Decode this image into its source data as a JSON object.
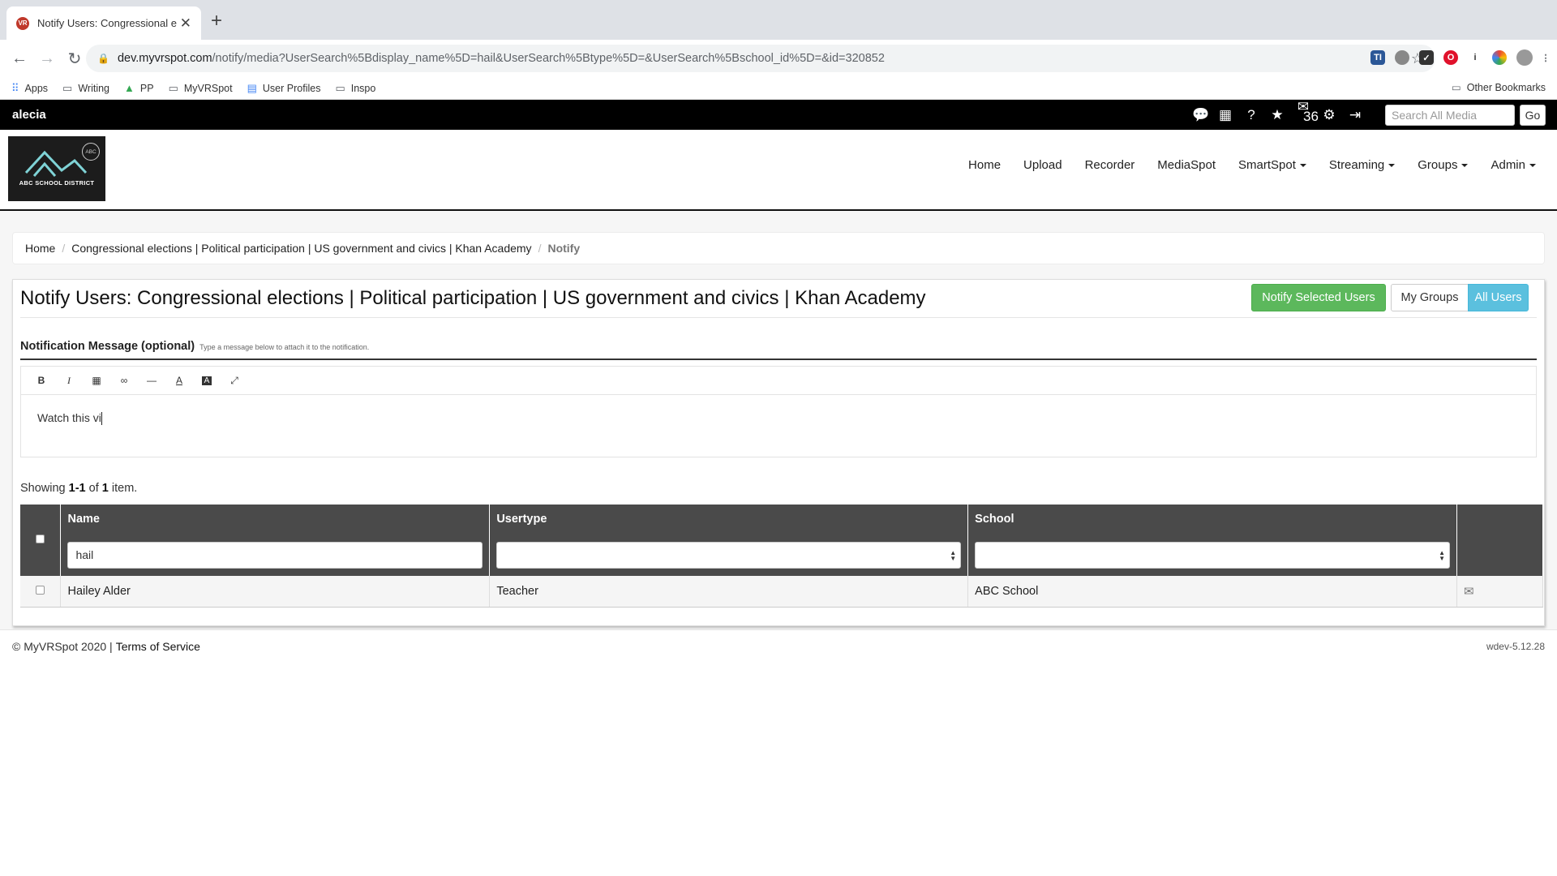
{
  "browser": {
    "tab_title": "Notify Users: Congressional el",
    "url_host": "dev.myvrspot.com",
    "url_path": "/notify/media?UserSearch%5Bdisplay_name%5D=hail&UserSearch%5Btype%5D=&UserSearch%5Bschool_id%5D=&id=320852",
    "bookmarks": [
      "Apps",
      "Writing",
      "PP",
      "MyVRSpot",
      "User Profiles",
      "Inspo"
    ],
    "other_bookmarks": "Other Bookmarks"
  },
  "topbar": {
    "username": "alecia",
    "mail_count": "36",
    "search_placeholder": "Search All Media",
    "go_label": "Go"
  },
  "logo": {
    "badge": "ABC",
    "district_name": "ABC SCHOOL DISTRICT"
  },
  "nav": {
    "home": "Home",
    "upload": "Upload",
    "recorder": "Recorder",
    "mediaspot": "MediaSpot",
    "smartspot": "SmartSpot",
    "streaming": "Streaming",
    "groups": "Groups",
    "admin": "Admin"
  },
  "breadcrumb": {
    "home": "Home",
    "media": "Congressional elections | Political participation | US government and civics | Khan Academy",
    "current": "Notify"
  },
  "page": {
    "title": "Notify Users: Congressional elections | Political participation | US government and civics | Khan Academy",
    "notify_button": "Notify Selected Users",
    "my_groups_button": "My Groups",
    "all_users_button": "All Users",
    "message_label": "Notification Message (optional)",
    "message_hint": "Type a message below to attach it to the notification.",
    "message_text": "Watch this vi"
  },
  "summary": {
    "prefix": "Showing ",
    "range": "1-1",
    "of": " of ",
    "total": "1",
    "suffix": " item."
  },
  "table": {
    "headers": {
      "name": "Name",
      "usertype": "Usertype",
      "school": "School"
    },
    "filters": {
      "name_value": "hail",
      "usertype_value": "",
      "school_value": ""
    },
    "rows": [
      {
        "name": "Hailey Alder",
        "usertype": "Teacher",
        "school": "ABC School"
      }
    ]
  },
  "footer": {
    "copyright": "© MyVRSpot 2020 |",
    "terms": "Terms of Service",
    "version": "wdev-5.12.28"
  },
  "colors": {
    "notify_green": "#5cb85c",
    "all_users_blue": "#5bc0de",
    "table_header": "#4a4a4a"
  }
}
